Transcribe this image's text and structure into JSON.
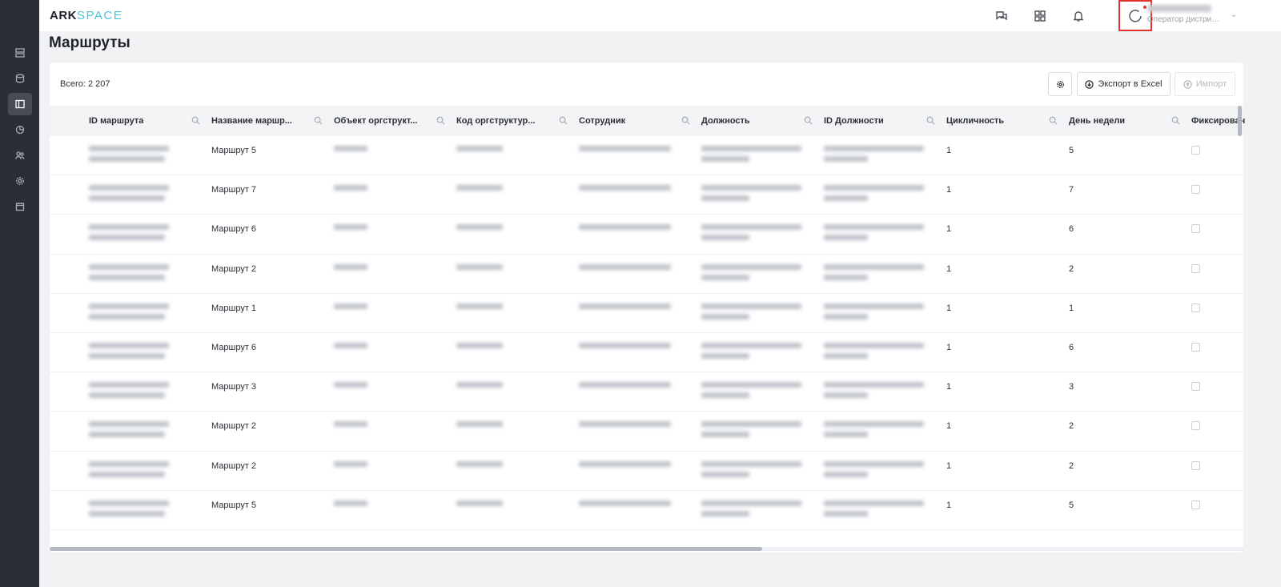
{
  "app": {
    "logo_main": "ARK",
    "logo_accent": "SPACE"
  },
  "sidebar": {
    "items": [
      {
        "icon": "server-icon"
      },
      {
        "icon": "database-icon"
      },
      {
        "icon": "routes-icon",
        "active": true
      },
      {
        "icon": "pie-chart-icon"
      },
      {
        "icon": "users-icon"
      },
      {
        "icon": "settings-icon"
      },
      {
        "icon": "calendar-icon"
      }
    ]
  },
  "header": {
    "icons": [
      "chat-icon",
      "grid-icon",
      "bell-icon",
      "loading-icon"
    ],
    "user": {
      "role": "Оператор дистрибу..."
    }
  },
  "page": {
    "title": "Маршруты"
  },
  "toolbar": {
    "total": "Всего: 2 207",
    "export_label": "Экспорт в Excel",
    "import_label": "Импорт"
  },
  "table": {
    "columns": [
      "ID маршрута",
      "Название маршр...",
      "Объект оргструкт...",
      "Код оргструктур...",
      "Сотрудник",
      "Должность",
      "ID Должности",
      "Цикличность",
      "День недели",
      "Фиксирован"
    ],
    "rows": [
      {
        "route_name": "Маршрут 5",
        "cycle": "1",
        "weekday": "5"
      },
      {
        "route_name": "Маршрут 7",
        "cycle": "1",
        "weekday": "7"
      },
      {
        "route_name": "Маршрут 6",
        "cycle": "1",
        "weekday": "6"
      },
      {
        "route_name": "Маршрут 2",
        "cycle": "1",
        "weekday": "2"
      },
      {
        "route_name": "Маршрут 1",
        "cycle": "1",
        "weekday": "1"
      },
      {
        "route_name": "Маршрут 6",
        "cycle": "1",
        "weekday": "6"
      },
      {
        "route_name": "Маршрут 3",
        "cycle": "1",
        "weekday": "3"
      },
      {
        "route_name": "Маршрут 2",
        "cycle": "1",
        "weekday": "2"
      },
      {
        "route_name": "Маршрут 2",
        "cycle": "1",
        "weekday": "2"
      },
      {
        "route_name": "Маршрут 5",
        "cycle": "1",
        "weekday": "5"
      }
    ]
  },
  "colors": {
    "sidebar_bg": "#2b2e36",
    "accent": "#4cc3d9",
    "highlight": "#e0322f"
  }
}
